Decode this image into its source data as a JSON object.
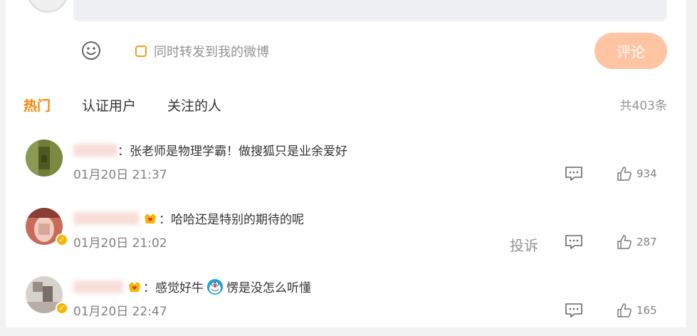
{
  "composer": {
    "repost_label": "同时转发到我的微博",
    "submit_label": "评论"
  },
  "tabs": [
    {
      "label": "热门",
      "active": true
    },
    {
      "label": "认证用户",
      "active": false
    },
    {
      "label": "关注的人",
      "active": false
    }
  ],
  "total": "共403条",
  "comments": [
    {
      "text": "：张老师是物理学霸！做搜狐只是业余爱好",
      "time": "01月20日 21:37",
      "likes": "934"
    },
    {
      "text": "：哈哈还是特别的期待的呢",
      "time": "01月20日 21:02",
      "likes": "287",
      "report_label": "投诉"
    },
    {
      "text_before": "：感觉好牛",
      "text_after": "愣是没怎么听懂",
      "time": "01月20日 22:47",
      "likes": "165"
    }
  ],
  "colors": {
    "accent": "#ff8200",
    "button_disabled": "#ffc5a3",
    "username": "#eb7350"
  }
}
